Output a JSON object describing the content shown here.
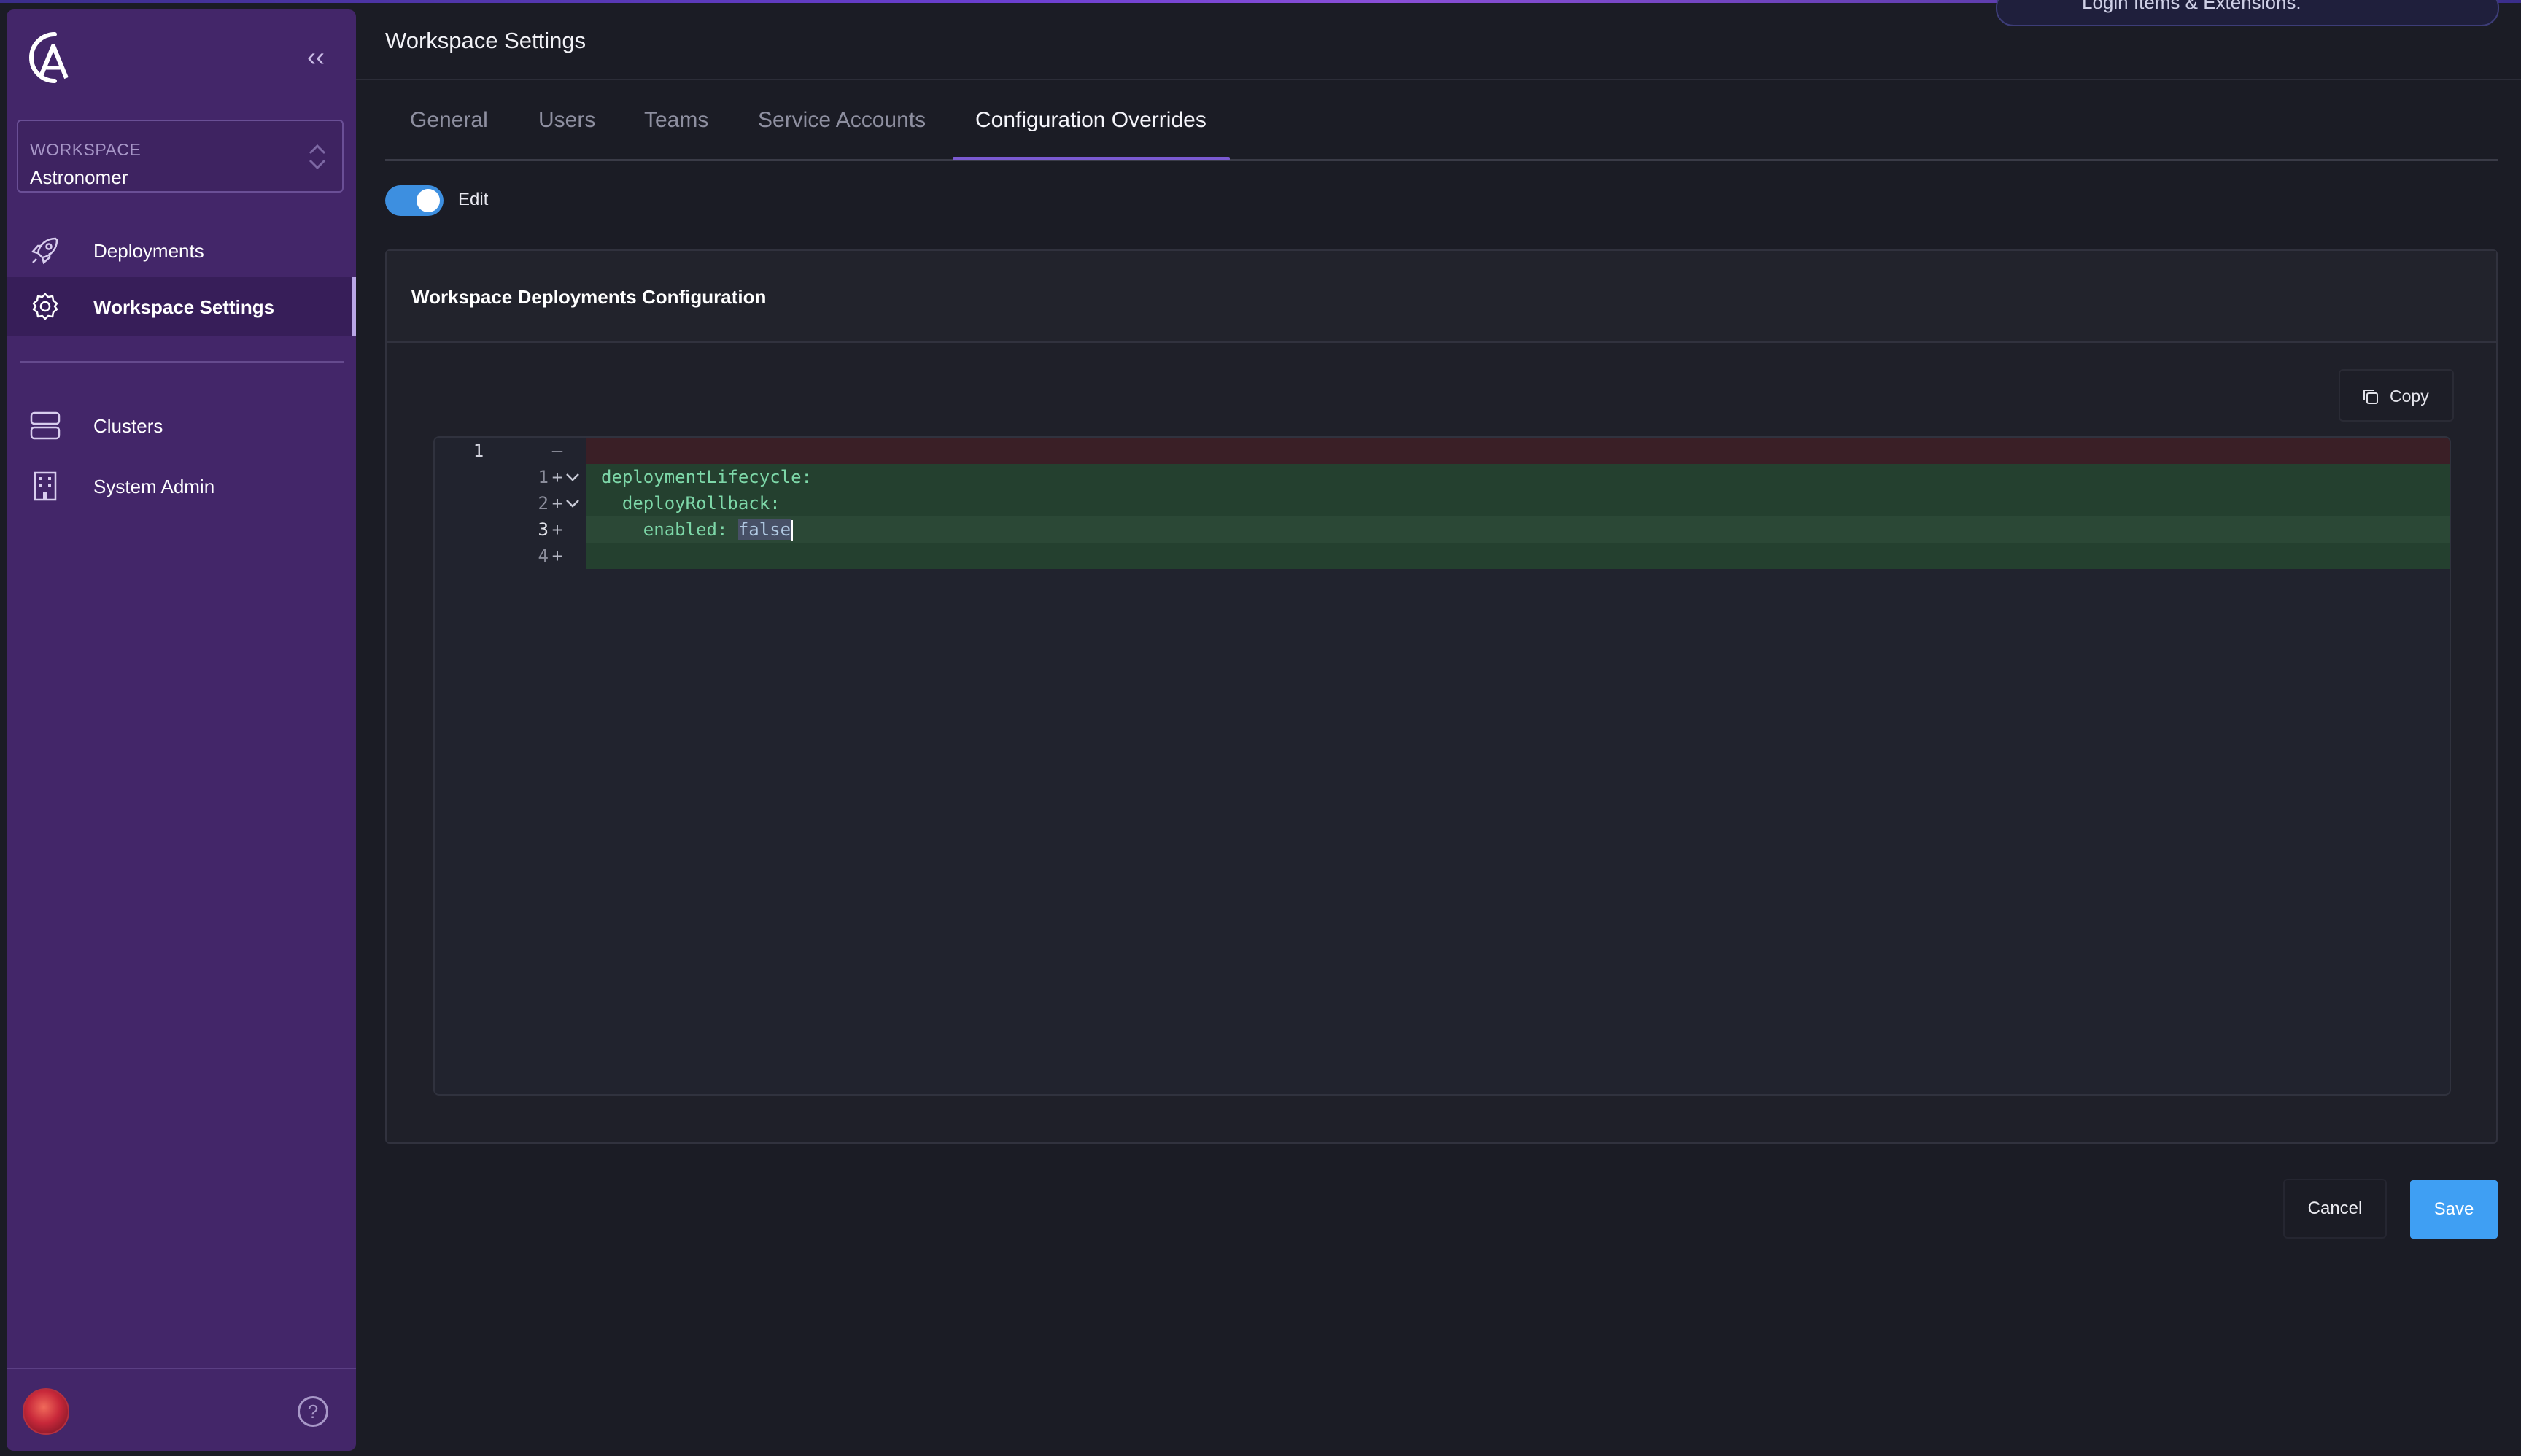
{
  "notification": {
    "text": "Login Items & Extensions."
  },
  "sidebar": {
    "logo_icon": "astronomer-logo-icon",
    "collapse_icon": "double-chevron-left-icon",
    "collapse_label": "‹‹",
    "workspace_label": "WORKSPACE",
    "workspace_value": "Astronomer",
    "items": [
      {
        "label": "Deployments",
        "icon": "rocket-icon",
        "active": false
      },
      {
        "label": "Workspace Settings",
        "icon": "gear-icon",
        "active": true
      },
      {
        "label": "Clusters",
        "icon": "server-icon",
        "active": false
      },
      {
        "label": "System Admin",
        "icon": "building-icon",
        "active": false
      }
    ],
    "help_label": "?"
  },
  "header": {
    "title": "Workspace Settings"
  },
  "tabs": [
    {
      "label": "General",
      "active": false
    },
    {
      "label": "Users",
      "active": false
    },
    {
      "label": "Teams",
      "active": false
    },
    {
      "label": "Service Accounts",
      "active": false
    },
    {
      "label": "Configuration Overrides",
      "active": true
    }
  ],
  "edit_toggle": {
    "label": "Edit",
    "on": true
  },
  "config_card": {
    "title": "Workspace Deployments Configuration",
    "copy_label": "Copy",
    "editor": {
      "removed": [
        {
          "old_line": "1",
          "sign": "–",
          "text": ""
        }
      ],
      "added": [
        {
          "new_line": "1",
          "sign": "+",
          "text": "deploymentLifecycle:",
          "foldable": true
        },
        {
          "new_line": "2",
          "sign": "+",
          "text": "  deployRollback:",
          "foldable": true
        },
        {
          "new_line": "3",
          "sign": "+",
          "text_prefix": "    enabled: ",
          "selected": "false",
          "foldable": false,
          "current": true
        },
        {
          "new_line": "4",
          "sign": "+",
          "text": "",
          "foldable": false
        }
      ]
    }
  },
  "footer": {
    "cancel_label": "Cancel",
    "save_label": "Save"
  },
  "colors": {
    "sidebar_bg": "#432669",
    "accent_purple": "#7b5ad2",
    "primary_blue": "#3f9ff3",
    "diff_added_bg": "#24402f",
    "diff_removed_bg": "#3a1f26",
    "code_green": "#7dd7a8"
  }
}
